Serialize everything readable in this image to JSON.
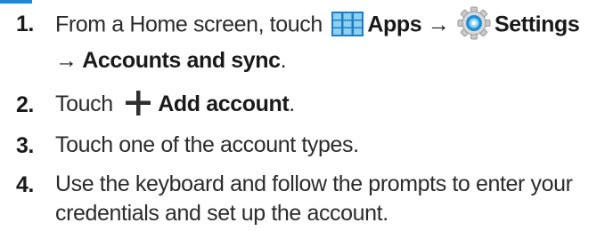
{
  "steps": [
    {
      "number": "1.",
      "line1": {
        "pre": "From a Home screen, touch ",
        "apps_label": "Apps",
        "arrow1": " → ",
        "settings_label": "Settings"
      },
      "line2": {
        "arrow2": "→ ",
        "accounts_label": "Accounts and sync",
        "period": "."
      },
      "apps_icon": "apps-grid-icon",
      "settings_icon": "gear-icon"
    },
    {
      "number": "2.",
      "pre": "Touch ",
      "add_label": "Add account",
      "period": ".",
      "plus_icon": "plus-icon"
    },
    {
      "number": "3.",
      "text": "Touch one of the account types."
    },
    {
      "number": "4.",
      "line1": "Use the keyboard and follow the prompts to enter your",
      "line2": "credentials and set up the account."
    }
  ],
  "colors": {
    "accent_blue": "#1c89d1",
    "text": "#2b2b2b"
  }
}
